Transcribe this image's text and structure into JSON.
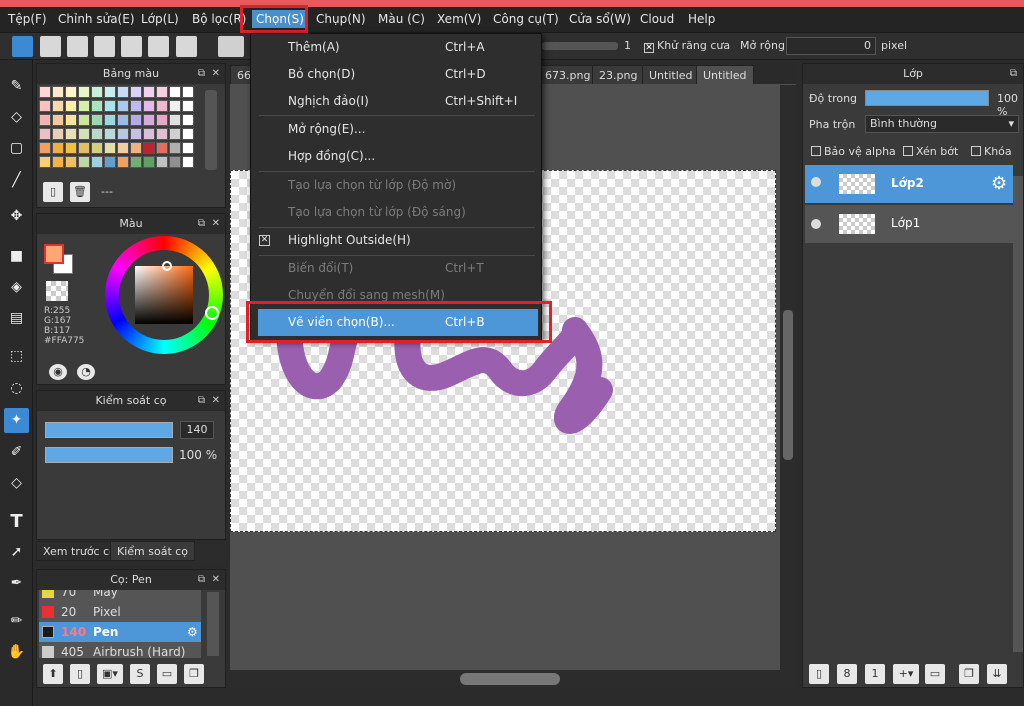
{
  "menubar": {
    "items": [
      "Tệp(F)",
      "Chỉnh sửa(E)",
      "Lớp(L)",
      "Bộ lọc(R)",
      "Chọn(S)",
      "Chụp(N)",
      "Màu (C)",
      "Xem(V)",
      "Công cụ(T)",
      "Cửa sổ(W)",
      "Cloud",
      "Help"
    ],
    "active": "Chọn(S)"
  },
  "toolbar": {
    "value_1": "1",
    "antialias_label": "Khử răng cưa",
    "expand_label": "Mở rộng",
    "expand_value": "0",
    "unit": "pixel"
  },
  "dropdown": {
    "items": [
      {
        "label": "Thêm(A)",
        "shortcut": "Ctrl+A"
      },
      {
        "label": "Bỏ chọn(D)",
        "shortcut": "Ctrl+D"
      },
      {
        "label": "Nghịch đảo(I)",
        "shortcut": "Ctrl+Shift+I"
      },
      {
        "label": "Mở rộng(E)...",
        "shortcut": ""
      },
      {
        "label": "Hợp đồng(C)...",
        "shortcut": ""
      },
      {
        "label": "Tạo lựa chọn từ lớp (Độ mờ)",
        "shortcut": ""
      },
      {
        "label": "Tạo lựa chọn từ lớp (Độ sáng)",
        "shortcut": ""
      },
      {
        "label": "Highlight Outside(H)",
        "shortcut": "",
        "checked": true
      },
      {
        "label": "Biến đổi(T)",
        "shortcut": "Ctrl+T"
      },
      {
        "label": "Chuyển đổi sang mesh(M)",
        "shortcut": ""
      },
      {
        "label": "Vẽ viền chọn(B)...",
        "shortcut": "Ctrl+B"
      }
    ]
  },
  "tabs": [
    "66",
    "673.png",
    "23.png",
    "Untitled",
    "Untitled"
  ],
  "palette_panel": {
    "title": "Bảng màu",
    "name_value": "---"
  },
  "color_panel": {
    "title": "Màu",
    "r": "R:255",
    "g": "G:167",
    "b": "B:117",
    "hex": "#FFA775",
    "fg_color": "#FFA775"
  },
  "brush_control": {
    "title": "Kiểm soát cọ",
    "size": "140",
    "opacity": "100 %"
  },
  "bottom_tabs": [
    "Xem trước cọ",
    "Kiểm soát cọ"
  ],
  "brush_panel": {
    "title": "Cọ: Pen",
    "items": [
      {
        "size": "70",
        "name": "Mây",
        "color": "#e8d640"
      },
      {
        "size": "20",
        "name": "Pixel",
        "color": "#e83030"
      },
      {
        "size": "140",
        "name": "Pen",
        "color": "#1a1a1a",
        "selected": true
      },
      {
        "size": "405",
        "name": "Airbrush (Hard)",
        "color": "#cccccc"
      }
    ]
  },
  "layer_panel": {
    "title": "Lớp",
    "opacity_label": "Độ trong",
    "opacity_value": "100 %",
    "opacity_fraction": 1.0,
    "blend_label": "Pha trộn",
    "blend_value": "Bình thường",
    "protect_alpha": "Bảo vệ alpha",
    "clipping": "Xén bớt",
    "lock": "Khóa",
    "layers": [
      {
        "name": "Lớp2",
        "selected": true
      },
      {
        "name": "Lớp1",
        "selected": false
      }
    ]
  },
  "colors": {
    "accent": "#4d97d8",
    "highlight_box": "#e0202a",
    "stroke": "#9b5fb0"
  }
}
